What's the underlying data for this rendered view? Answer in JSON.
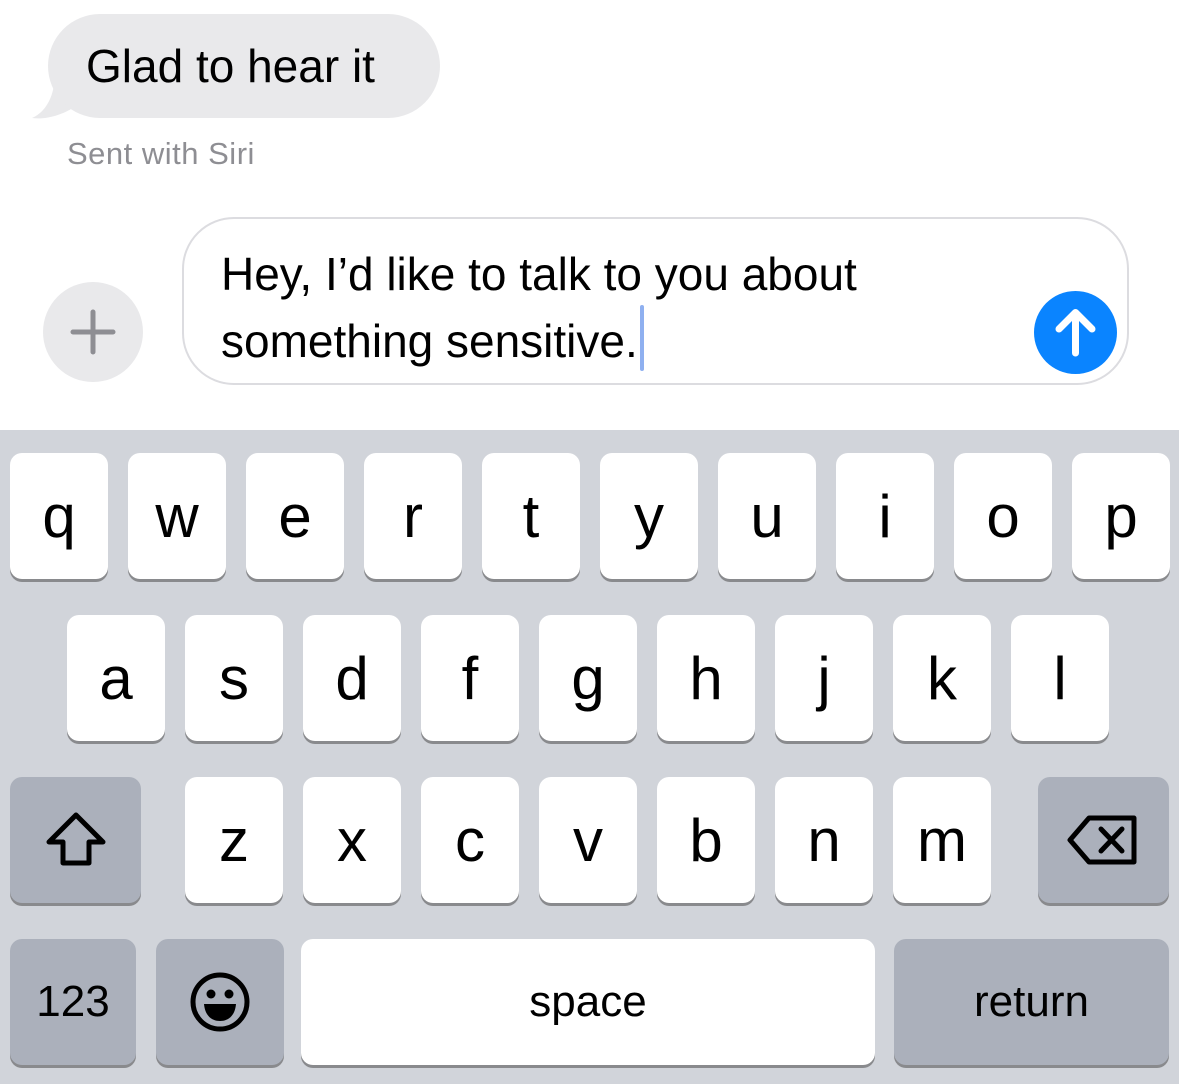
{
  "conversation": {
    "received_message": "Glad to hear it",
    "received_caption": "Sent with Siri"
  },
  "composer": {
    "text": "Hey, I’d like to talk to you about something sensitive.",
    "line1": "Hey, I’d like to talk to you about",
    "line2": "something sensitive.",
    "plus_icon": "plus-icon",
    "send_icon": "arrow-up-icon",
    "send_color": "#0a84ff"
  },
  "keyboard": {
    "row1": [
      "q",
      "w",
      "e",
      "r",
      "t",
      "y",
      "u",
      "i",
      "o",
      "p"
    ],
    "row2": [
      "a",
      "s",
      "d",
      "f",
      "g",
      "h",
      "j",
      "k",
      "l"
    ],
    "row3": [
      "z",
      "x",
      "c",
      "v",
      "b",
      "n",
      "m"
    ],
    "numbers_label": "123",
    "space_label": "space",
    "return_label": "return",
    "shift_icon": "shift-icon",
    "delete_icon": "delete-icon",
    "emoji_icon": "emoji-icon"
  }
}
